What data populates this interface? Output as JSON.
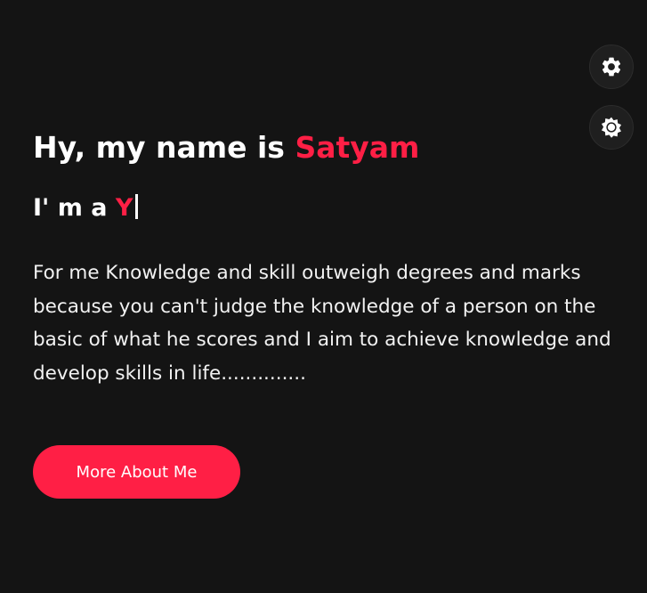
{
  "hero": {
    "greeting_prefix": "Hy, my name is ",
    "name": "Satyam"
  },
  "typing": {
    "prefix": "I' m a ",
    "typed": "Y"
  },
  "bio": {
    "text": "For me Knowledge and skill outweigh degrees and marks because you can't judge the knowledge of a person on the basic of what he scores and I aim to achieve knowledge and develop skills in life.............."
  },
  "cta": {
    "label": "More About Me"
  },
  "controls": {
    "settings_icon": "gear-icon",
    "theme_icon": "sun-icon"
  },
  "colors": {
    "background": "#141414",
    "accent": "#ff1f45",
    "text": "#ffffff"
  }
}
